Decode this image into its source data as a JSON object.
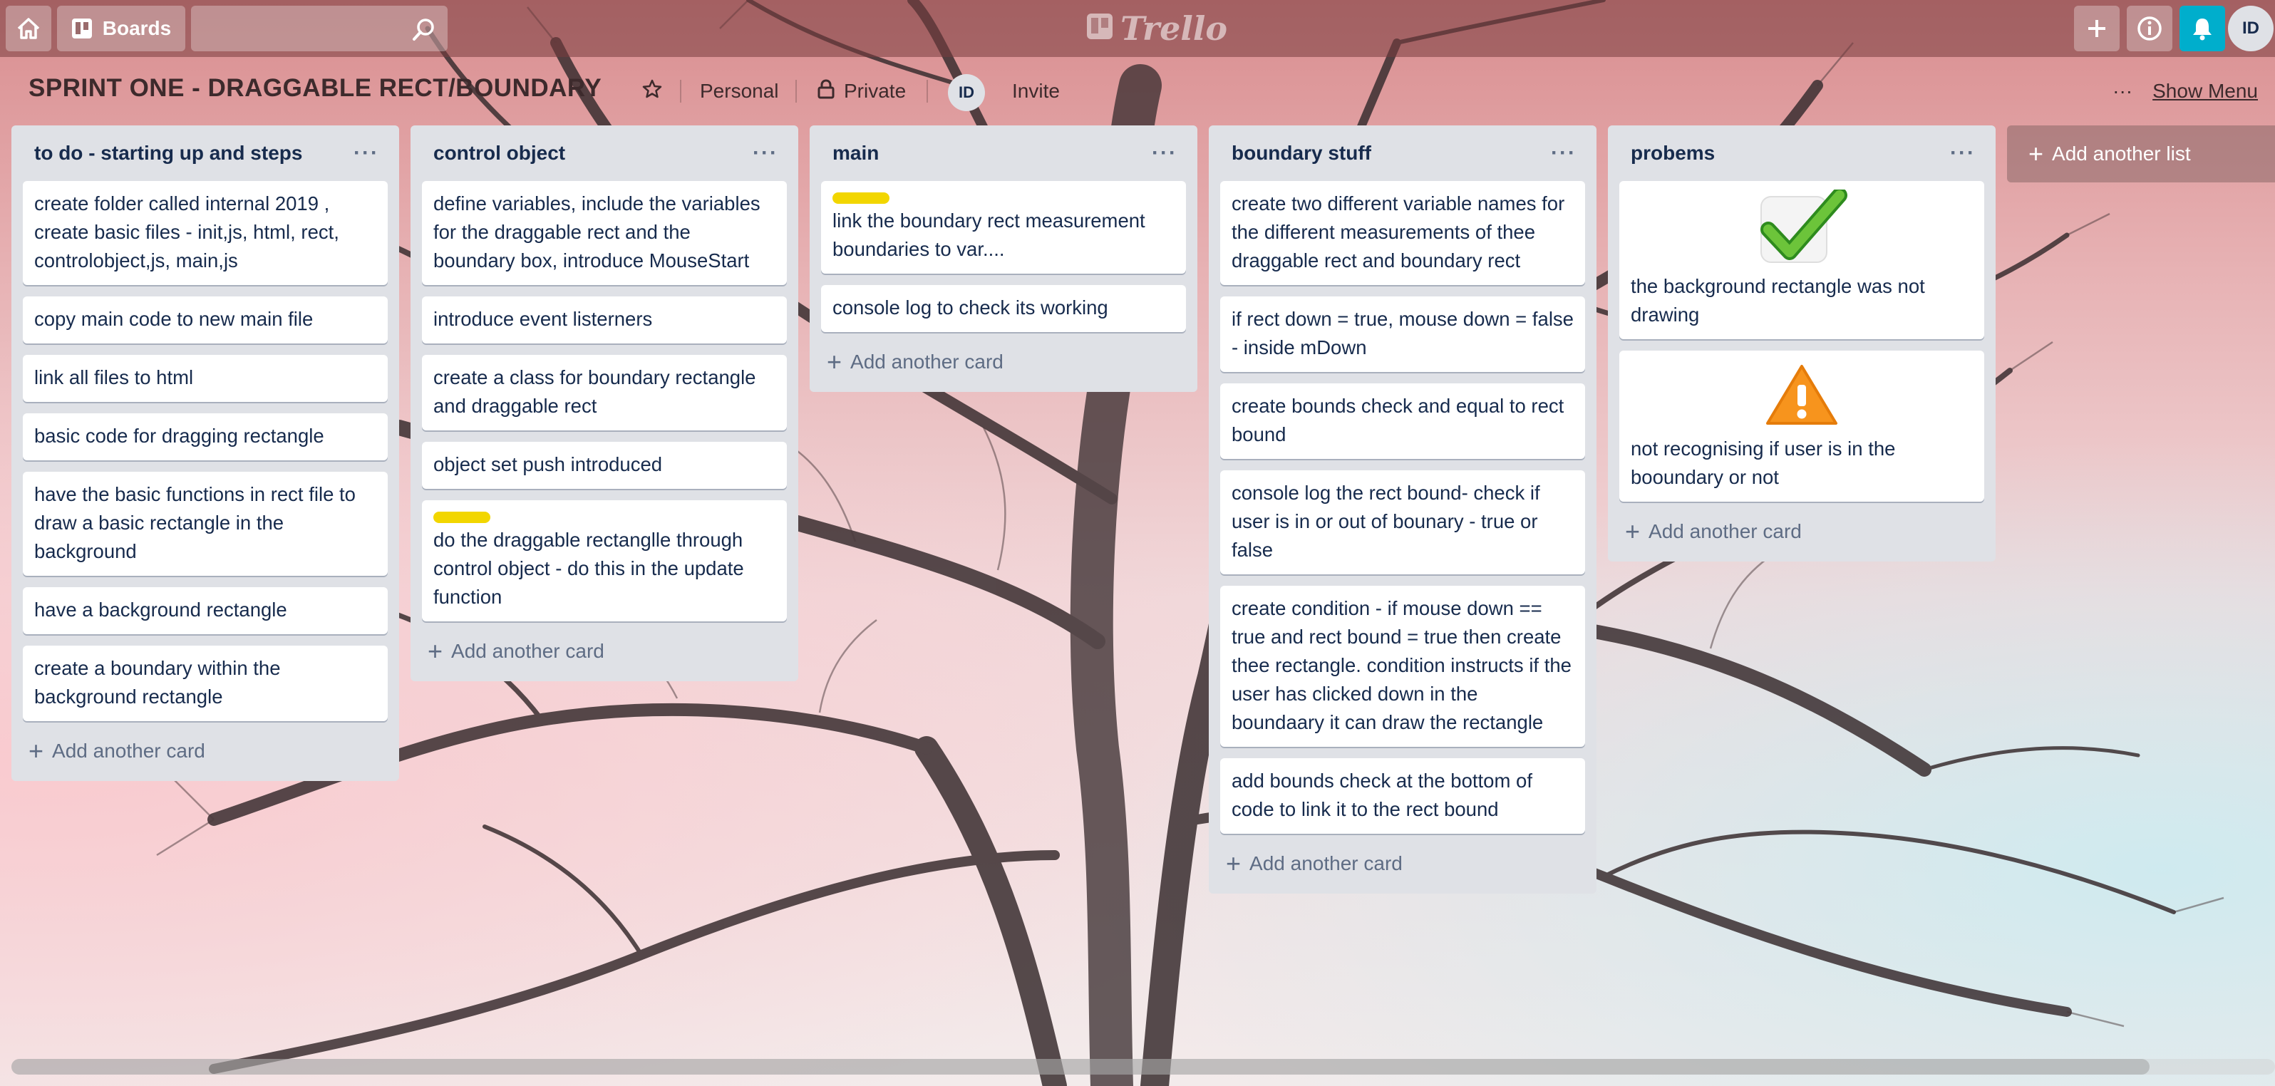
{
  "app": {
    "logo_text": "Trello",
    "boards_label": "Boards",
    "user_initials": "ID"
  },
  "search": {
    "placeholder": ""
  },
  "board": {
    "title": "SPRINT ONE - DRAGGABLE RECT/BOUNDARY",
    "team": "Personal",
    "visibility": "Private",
    "member_initials": "ID",
    "invite_label": "Invite",
    "show_menu_label": "Show Menu",
    "more_glyph": "···"
  },
  "lists": [
    {
      "title": "to do - starting up and steps",
      "menu_glyph": "···",
      "cards": [
        {
          "text": "create folder called internal 2019 , create basic files - init,js, html, rect, controlobject,js, main,js"
        },
        {
          "text": "copy main code to new main file"
        },
        {
          "text": "link all files to html"
        },
        {
          "text": "basic code for dragging rectangle"
        },
        {
          "text": "have the basic functions in rect file to draw a basic rectangle in the background"
        },
        {
          "text": "have a background rectangle"
        },
        {
          "text": "create a boundary within the background rectangle"
        }
      ],
      "add_card_label": "Add another card"
    },
    {
      "title": "control object",
      "menu_glyph": "···",
      "cards": [
        {
          "text": "define variables, include the variables for the draggable rect and the boundary box, introduce MouseStart"
        },
        {
          "text": "introduce event listerners"
        },
        {
          "text": "create a class for boundary rectangle and draggable rect"
        },
        {
          "text": "object set push introduced"
        },
        {
          "text": "do the draggable rectanglle through control object - do this in the update function",
          "label": "yellow"
        }
      ],
      "add_card_label": "Add another card"
    },
    {
      "title": "main",
      "menu_glyph": "···",
      "cards": [
        {
          "text": "link the boundary rect measurement boundaries to var....",
          "label": "yellow"
        },
        {
          "text": "console log to check its working"
        }
      ],
      "add_card_label": "Add another card"
    },
    {
      "title": "boundary stuff",
      "menu_glyph": "···",
      "cards": [
        {
          "text": "create two different variable names for the different measurements of thee draggable rect and boundary rect"
        },
        {
          "text": "if rect down = true, mouse down = false - inside mDown"
        },
        {
          "text": "create bounds check and equal to rect bound"
        },
        {
          "text": "console log the rect bound- check if user is in or out of bounary - true or false"
        },
        {
          "text": "create condition - if mouse down == true and rect bound = true then create thee rectangle. condition instructs if the user has clicked down in the boundaary it can draw the rectangle"
        },
        {
          "text": "add bounds check at the bottom of code to link it to the rect bound"
        }
      ],
      "add_card_label": "Add another card"
    },
    {
      "title": "probems",
      "menu_glyph": "···",
      "cards": [
        {
          "text": "the background rectangle was not drawing",
          "image": "checkmark-icon"
        },
        {
          "text": "not recognising if user is in the booundary or not",
          "image": "warning-icon"
        }
      ],
      "add_card_label": "Add another card"
    }
  ],
  "add_list_label": "Add another list",
  "colors": {
    "label_yellow": "#f2d600",
    "list_bg": "#dfe1e6",
    "notification_bg": "#00aecc"
  }
}
